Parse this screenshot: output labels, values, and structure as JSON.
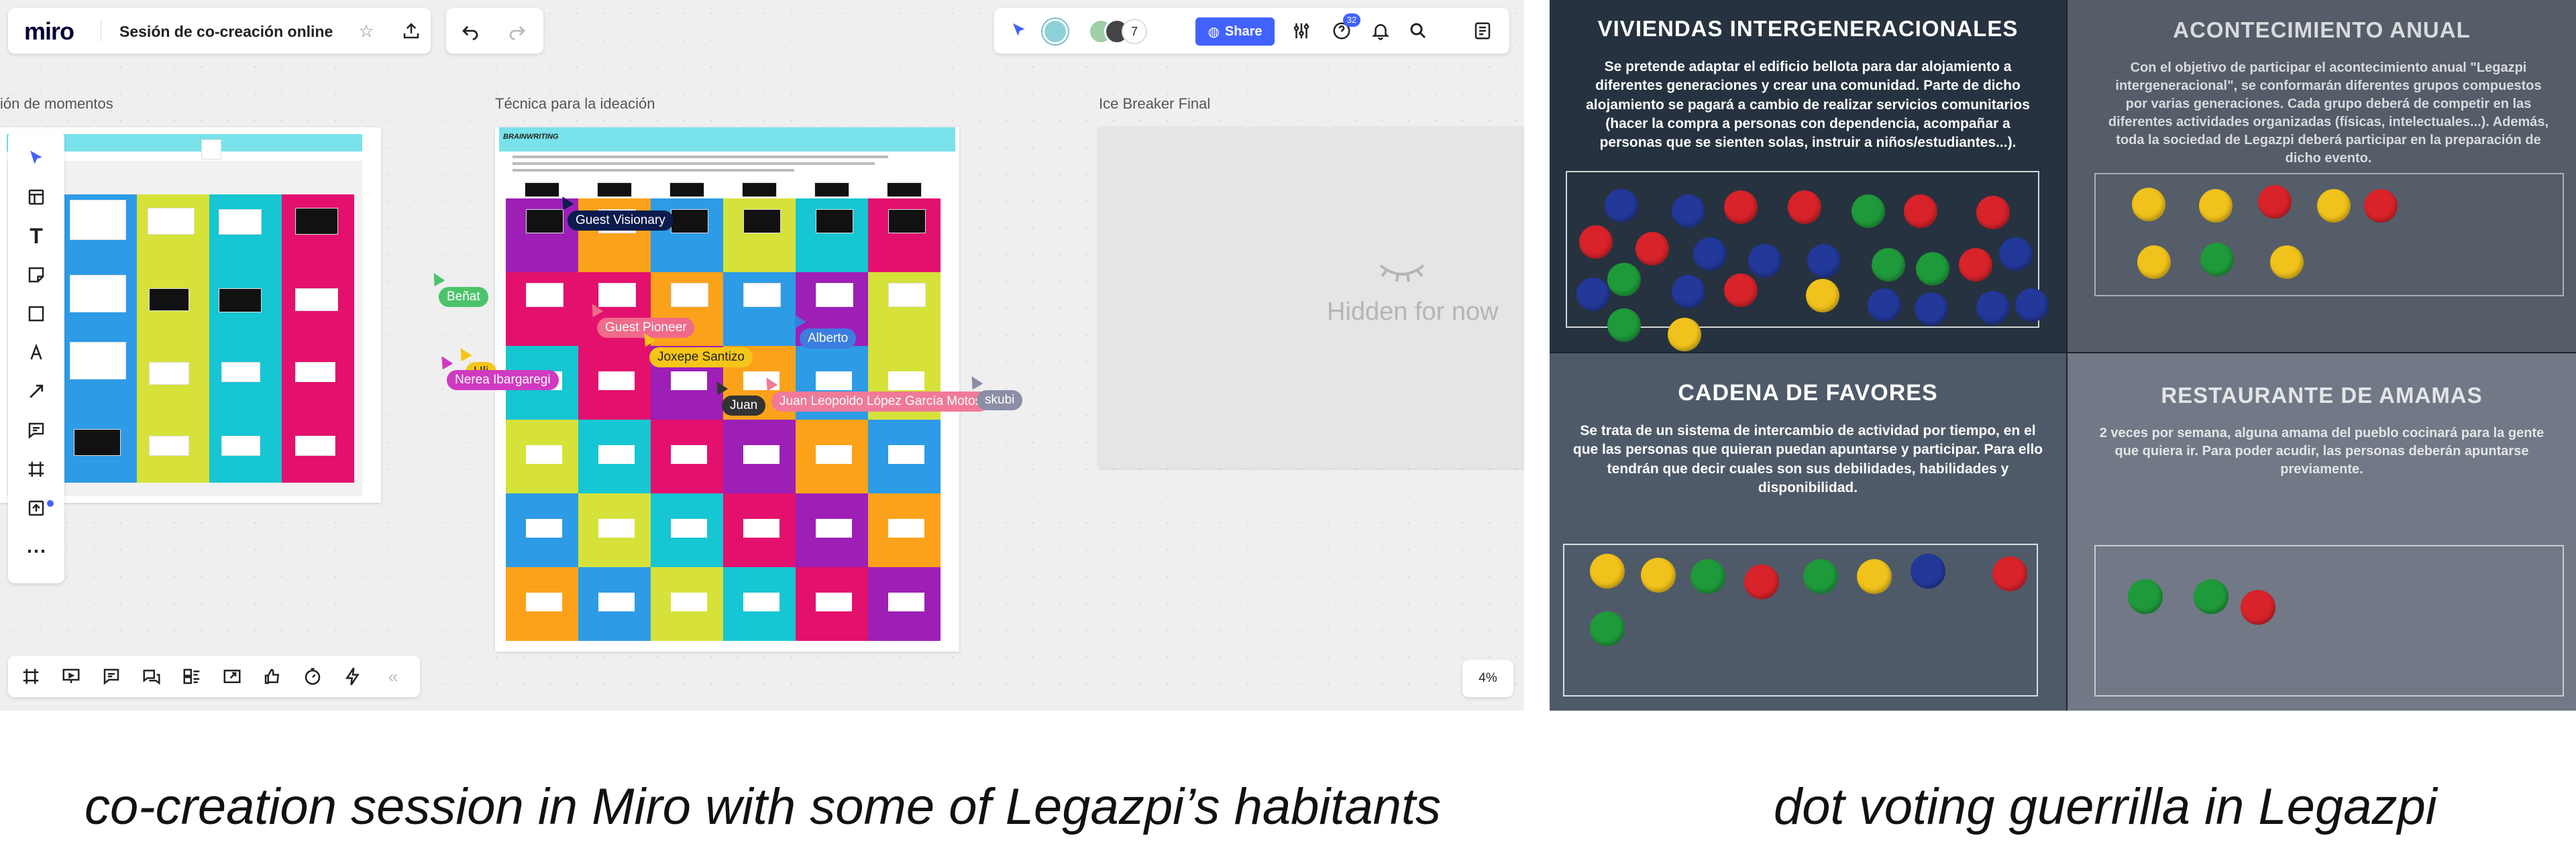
{
  "miro": {
    "logo": "miro",
    "board_title": "Sesión de co-creación online",
    "collaborator_count": "7",
    "share_label": "Share",
    "help_badge": "32",
    "zoom": "4%",
    "frames": {
      "left_title": "ión de momentos",
      "middle_title": "Técnica para la ideación",
      "right_title": "Ice Breaker Final",
      "hidden_label": "Hidden for now",
      "middle_header": "BRAINWRITING"
    },
    "cursors": [
      {
        "name": "Guest Visionary",
        "color": "#0b1b4d"
      },
      {
        "name": "Beñat",
        "color": "#4cc36b"
      },
      {
        "name": "Guest Pioneer",
        "color": "#f06b8a"
      },
      {
        "name": "Joxepe Santizo",
        "color": "#f5c518"
      },
      {
        "name": "Alberto",
        "color": "#3b7de0"
      },
      {
        "name": "Uli",
        "color": "#f5c518"
      },
      {
        "name": "Nerea Ibargaregi",
        "color": "#d03ac1"
      },
      {
        "name": "Juan Leopoldo López García Motos",
        "color": "#f07a98"
      },
      {
        "name": "Juan",
        "color": "#333333"
      },
      {
        "name": "skubi",
        "color": "#8a8fa6"
      }
    ]
  },
  "voting": {
    "panels": [
      {
        "title": "VIVIENDAS INTERGENERACIONALES",
        "body": "Se pretende adaptar el edificio bellota para dar alojamiento a diferentes generaciones y crear una comunidad. Parte de dicho alojamiento se pagará a cambio de realizar servicios comunitarios (hacer la compra a personas con dependencia, acompañar a personas que se sienten solas, instruir a niños/estudiantes...)."
      },
      {
        "title": "ACONTECIMIENTO ANUAL",
        "body": "Con el objetivo de participar el acontecimiento anual \"Legazpi intergeneracional\", se conformarán diferentes grupos compuestos por varias generaciones. Cada grupo deberá de competir en las diferentes actividades organizadas (físicas, intelectuales...). Además, toda la sociedad de Legazpi deberá participar en la preparación de dicho evento."
      },
      {
        "title": "CADENA DE FAVORES",
        "body": "Se trata de un sistema de intercambio de actividad por tiempo, en el que las personas que quieran puedan apuntarse y participar. Para ello tendrán que decir cuales son sus debilidades, habilidades y disponibilidad."
      },
      {
        "title": "RESTAURANTE DE AMAMAS",
        "body": "2 veces por semana, alguna amama del pueblo cocinará para la gente que quiera ir. Para poder acudir, las personas deberán apuntarse previamente."
      }
    ]
  },
  "captions": {
    "left": "co-creation session in Miro with some of Legazpi’s habitants",
    "right": "dot voting guerrilla in Legazpi"
  },
  "colors": {
    "magenta": "#e3106e",
    "yellow": "#d6e23a",
    "cyan": "#16c6d3",
    "blue": "#2d9be6",
    "orange": "#fba21a",
    "purple": "#9d1fb6",
    "dot_red": "#d8232a",
    "dot_green": "#1f9a3b",
    "dot_yellow": "#f1c21b",
    "dot_blue": "#23399a"
  }
}
